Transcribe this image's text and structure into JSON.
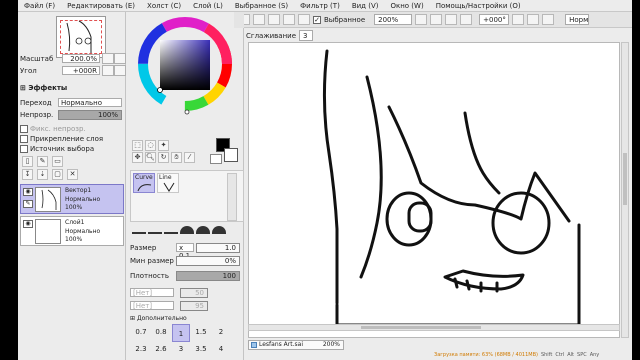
{
  "menu": {
    "items": [
      "Файл (F)",
      "Редактировать (E)",
      "Холст (C)",
      "Слой (L)",
      "Выбранное (S)",
      "Фильтр (T)",
      "Вид (V)",
      "Окно (W)",
      "Помощь/Настройки (O)"
    ]
  },
  "toolbar": {
    "selected_label": "Выбранное",
    "zoom_value": "200%",
    "angle_value": "+000°",
    "mode_value": "Норм"
  },
  "canvas_toolbar": {
    "stabilizer_label": "Сглаживание",
    "stabilizer_value": "3"
  },
  "navigator": {
    "zoom_label": "Масштаб",
    "zoom_value": "200.0%",
    "angle_label": "Угол",
    "angle_value": "+000R"
  },
  "effects": {
    "header": "Эффекты"
  },
  "layer_props": {
    "blend_label": "Переход",
    "blend_value": "Нормально",
    "opacity_label": "Непрозр.",
    "opacity_value": "100%",
    "protect_label": "Фикс. непрозр.",
    "clip_label": "Прикрепление слоя",
    "source_label": "Источник выбора"
  },
  "layers": [
    {
      "name": "Вектор1",
      "mode": "Нормально",
      "opacity": "100%",
      "selected": true
    },
    {
      "name": "Слой1",
      "mode": "Нормально",
      "opacity": "100%",
      "selected": false
    }
  ],
  "tools": {
    "curve_label": "Curve",
    "line_label": "Line"
  },
  "brush": {
    "size_label": "Размер",
    "size_mult": "x 0.1",
    "size_value": "1.0",
    "min_size_label": "Мин размер",
    "min_size_value": "0%",
    "density_label": "Плотность",
    "density_value": "100",
    "shape_placeholder": "[Нет]",
    "texture_placeholder": "[Нет]",
    "shape_strength": "50",
    "texture_strength": "95",
    "advanced_label": "Дополнительно",
    "sizes_row1": [
      "0.7",
      "0.8",
      "1",
      "1.5",
      "2"
    ],
    "sizes_row2": [
      "2.3",
      "2.6",
      "3",
      "3.5",
      "4"
    ]
  },
  "document": {
    "filename": "Lesfans Art.sai",
    "zoom": "200%"
  },
  "status": {
    "text": "Загрузка памяти: 63% (68MB / 4011MB)",
    "shift": "Shift",
    "ctrl": "Ctrl",
    "alt": "Alt",
    "spc": "SPC",
    "any": "Any"
  },
  "colors": {
    "primary": "#000000",
    "secondary": "#ffffff",
    "layer_selected": "#c5c3f0",
    "accent_bar": "#a8a8a8"
  }
}
